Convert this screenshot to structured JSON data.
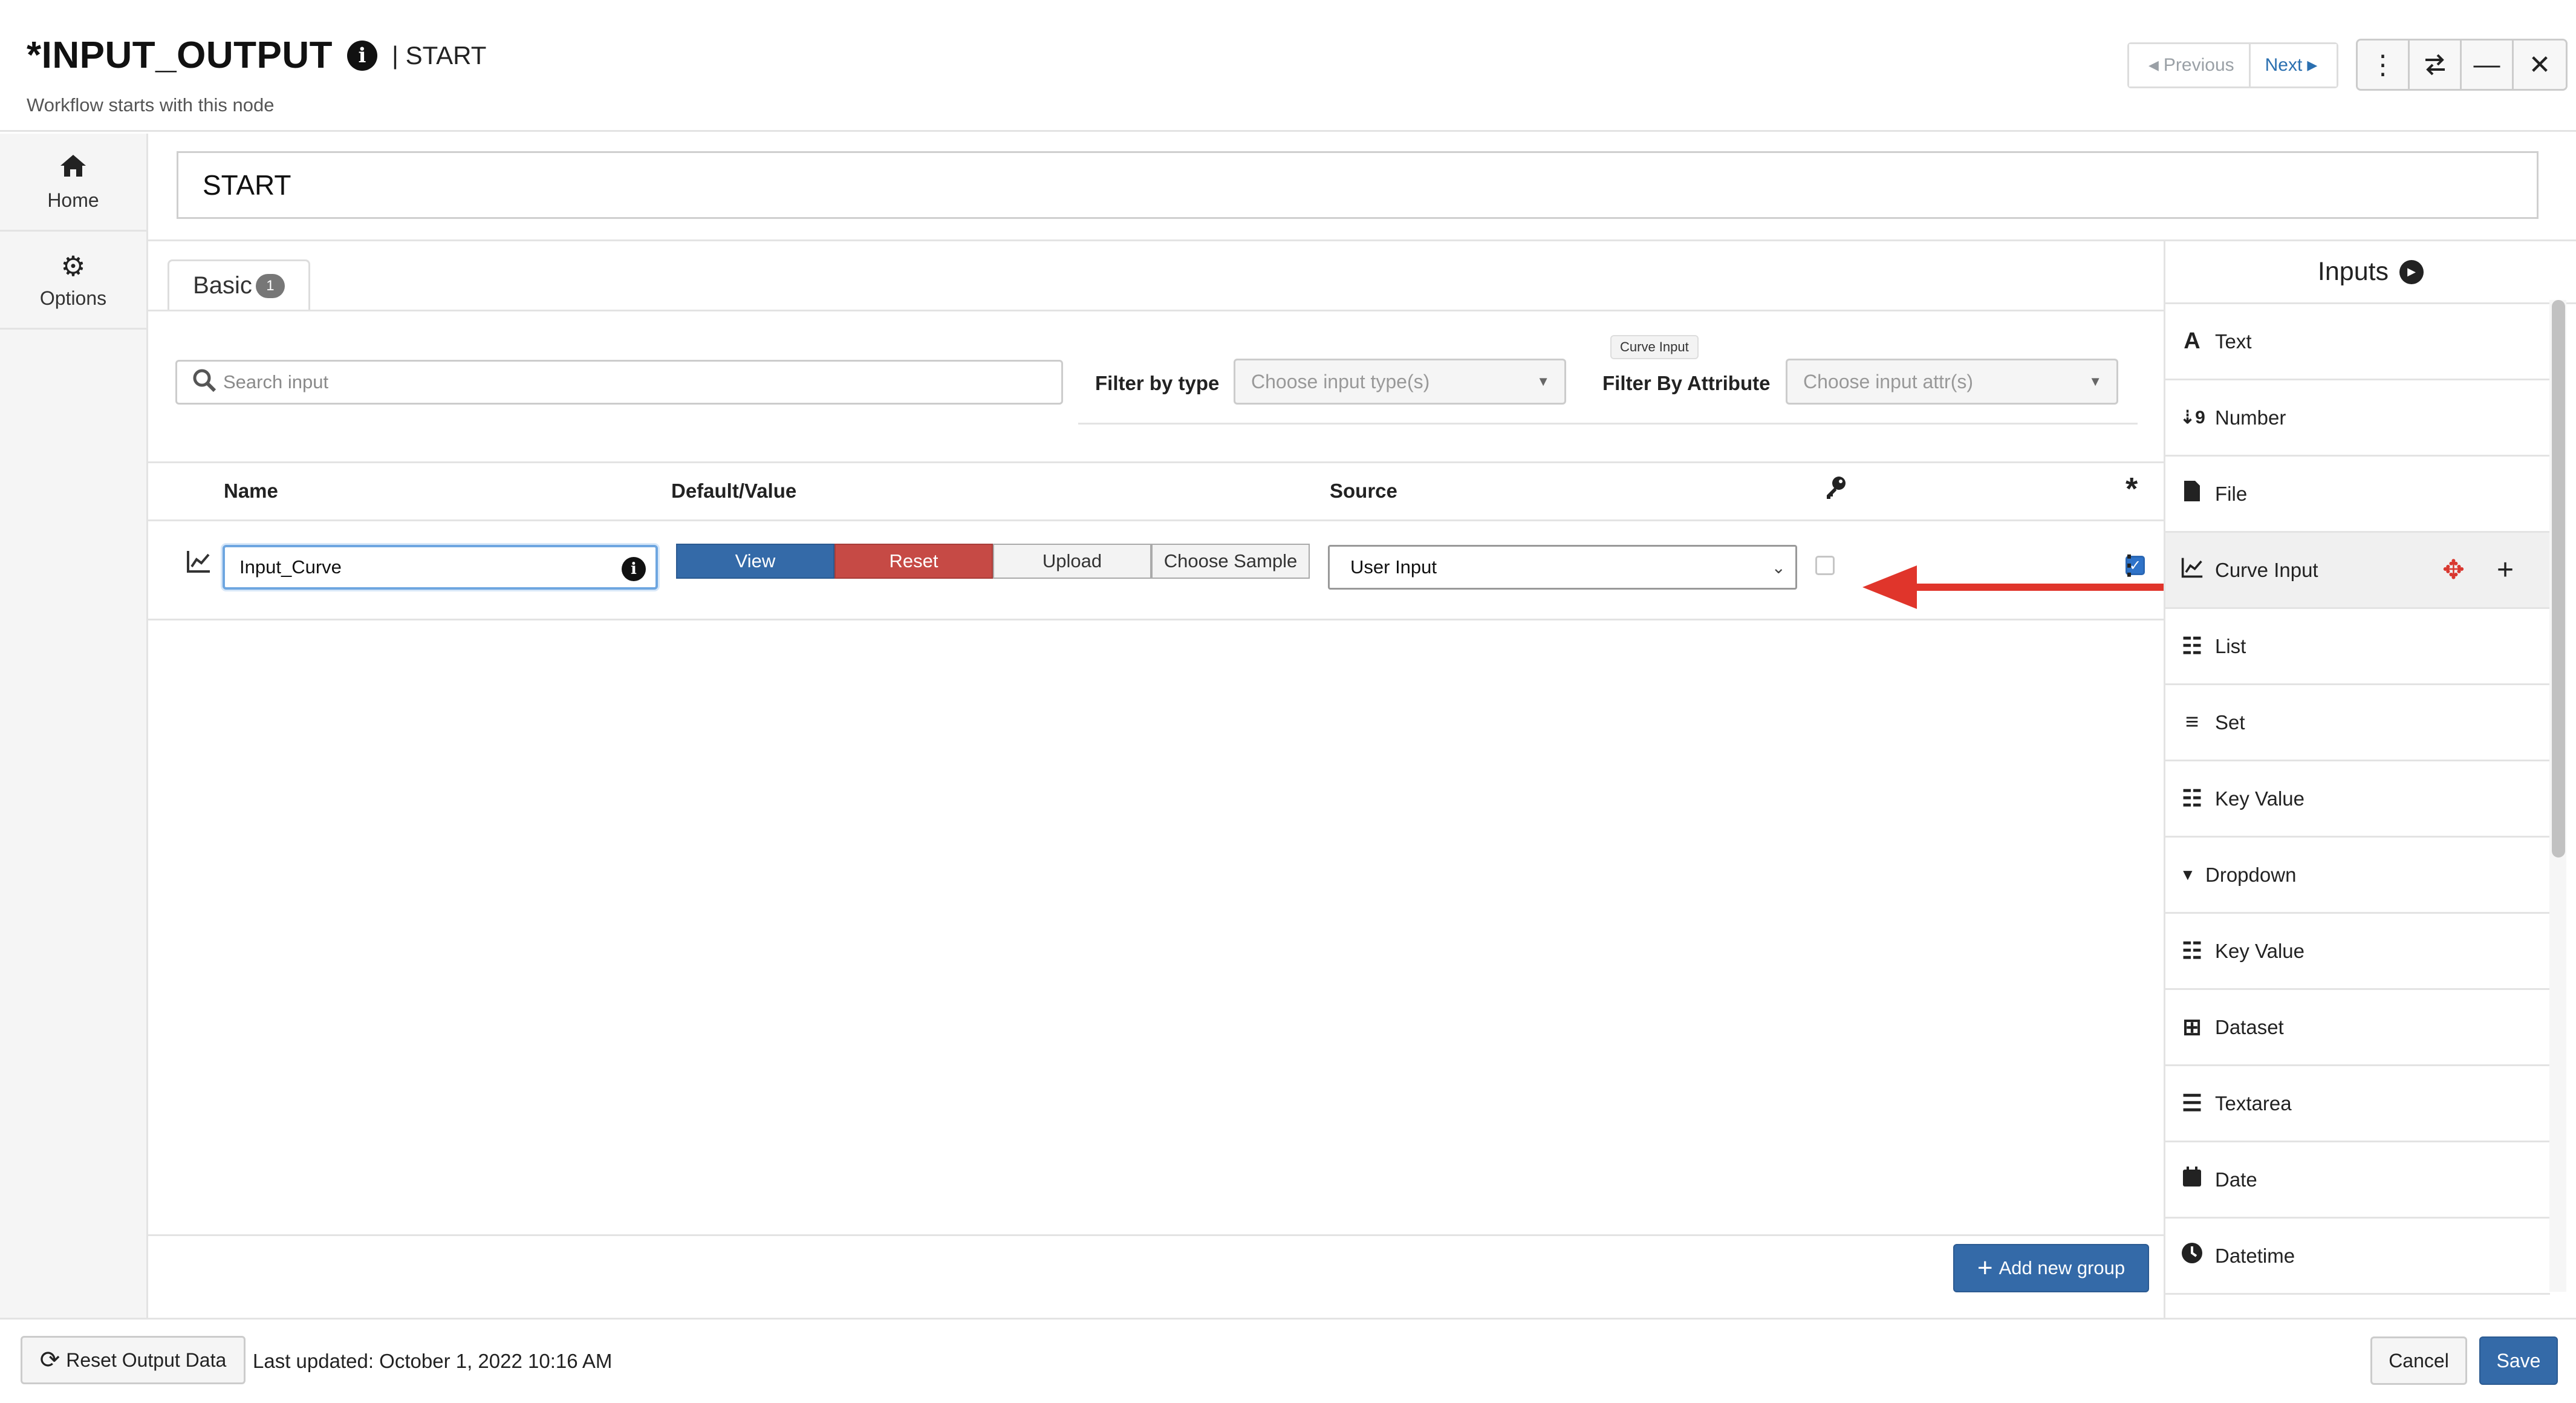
{
  "header": {
    "title": "*INPUT_OUTPUT",
    "separator": "| START",
    "subtitle": "Workflow starts with this node",
    "prev_label": "Previous",
    "next_label": "Next",
    "window_icons": [
      "kebab-icon",
      "swap-icon",
      "minimize-icon",
      "close-icon"
    ]
  },
  "leftnav": {
    "items": [
      {
        "label": "Home",
        "icon": "home-icon"
      },
      {
        "label": "Options",
        "icon": "gear-icon"
      }
    ]
  },
  "node_name": "START",
  "tabs": [
    {
      "label": "Basic",
      "badge": "1"
    }
  ],
  "filters": {
    "search_placeholder": "Search input",
    "type_label": "Filter by type",
    "type_placeholder": "Choose input type(s)",
    "attr_label": "Filter By Attribute",
    "attr_placeholder": "Choose input attr(s)",
    "tooltip": "Curve Input"
  },
  "table": {
    "columns": {
      "name": "Name",
      "default": "Default/Value",
      "source": "Source"
    },
    "rows": [
      {
        "icon": "line-chart-icon",
        "name": "Input_Curve",
        "buttons": {
          "view": "View",
          "reset": "Reset",
          "upload": "Upload",
          "sample": "Choose Sample"
        },
        "source": "User Input",
        "key_checked": false,
        "required_checked": true
      }
    ]
  },
  "add_group_label": "Add new group",
  "inputs_panel": {
    "title": "Inputs",
    "items": [
      {
        "label": "Text",
        "icon": "text-icon"
      },
      {
        "label": "Number",
        "icon": "number-sort-icon"
      },
      {
        "label": "File",
        "icon": "file-icon"
      },
      {
        "label": "Curve Input",
        "icon": "line-chart-icon",
        "active": true
      },
      {
        "label": "List",
        "icon": "list-icon"
      },
      {
        "label": "Set",
        "icon": "bars-icon"
      },
      {
        "label": "Key Value",
        "icon": "list-icon"
      },
      {
        "label": "Dropdown",
        "icon": "caret-down-icon"
      },
      {
        "label": "Key Value",
        "icon": "list-icon"
      },
      {
        "label": "Dataset",
        "icon": "table-icon"
      },
      {
        "label": "Textarea",
        "icon": "align-left-icon"
      },
      {
        "label": "Date",
        "icon": "calendar-icon"
      },
      {
        "label": "Datetime",
        "icon": "clock-icon"
      }
    ]
  },
  "bottom": {
    "reset_label": "Reset Output Data",
    "last_updated": "Last updated: October 1, 2022 10:16 AM",
    "cancel_label": "Cancel",
    "save_label": "Save"
  },
  "colors": {
    "primary": "#346aa8",
    "danger": "#c64a45",
    "accent_arrow": "#e0352b"
  }
}
